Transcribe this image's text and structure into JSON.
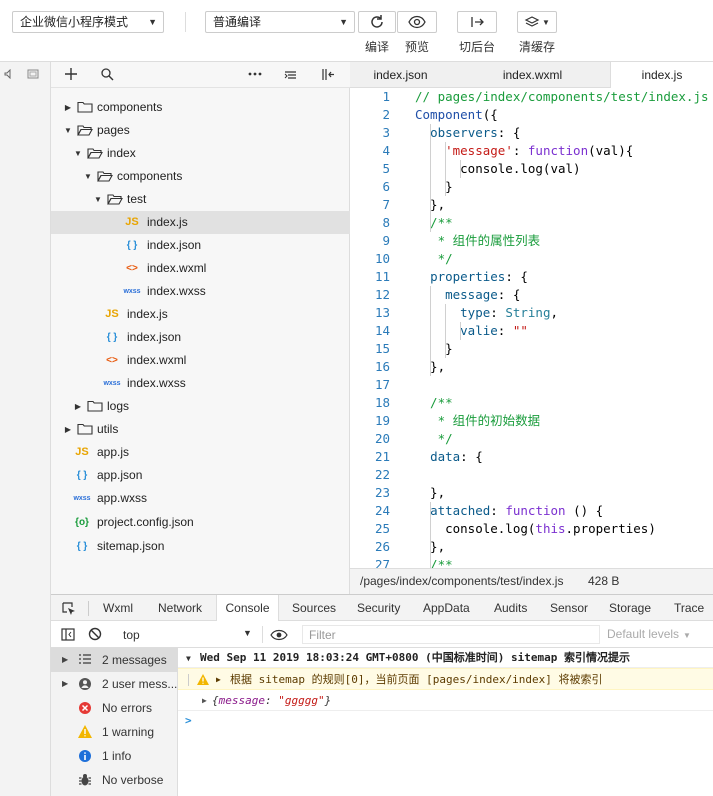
{
  "toolbar": {
    "mode_select": "企业微信小程序模式",
    "compile_select": "普通编译",
    "buttons": [
      {
        "label": "编译",
        "icon": "refresh-icon"
      },
      {
        "label": "预览",
        "icon": "eye-icon"
      },
      {
        "label": "切后台",
        "icon": "switch-background-icon"
      },
      {
        "label": "清缓存",
        "icon": "layers-icon"
      }
    ]
  },
  "tree": {
    "items": [
      {
        "label": "components",
        "type": "folder",
        "expanded": false
      },
      {
        "label": "pages",
        "type": "folder",
        "expanded": true
      },
      {
        "label": "index",
        "type": "folder",
        "expanded": true
      },
      {
        "label": "components",
        "type": "folder",
        "expanded": true
      },
      {
        "label": "test",
        "type": "folder",
        "expanded": true
      },
      {
        "label": "index.js",
        "type": "js",
        "icon_text": "JS"
      },
      {
        "label": "index.json",
        "type": "json",
        "icon_text": "{ }"
      },
      {
        "label": "index.wxml",
        "type": "wxml",
        "icon_text": "<>"
      },
      {
        "label": "index.wxss",
        "type": "wxss",
        "icon_text": "wxss"
      },
      {
        "label": "index.js",
        "type": "js",
        "icon_text": "JS"
      },
      {
        "label": "index.json",
        "type": "json",
        "icon_text": "{ }"
      },
      {
        "label": "index.wxml",
        "type": "wxml",
        "icon_text": "<>"
      },
      {
        "label": "index.wxss",
        "type": "wxss",
        "icon_text": "wxss"
      },
      {
        "label": "logs",
        "type": "folder",
        "expanded": false
      },
      {
        "label": "utils",
        "type": "folder",
        "expanded": false
      },
      {
        "label": "app.js",
        "type": "js",
        "icon_text": "JS"
      },
      {
        "label": "app.json",
        "type": "json",
        "icon_text": "{ }"
      },
      {
        "label": "app.wxss",
        "type": "wxss",
        "icon_text": "wxss"
      },
      {
        "label": "project.config.json",
        "type": "cfg",
        "icon_text": "{o}"
      },
      {
        "label": "sitemap.json",
        "type": "json",
        "icon_text": "{ }"
      }
    ]
  },
  "tabs": [
    "index.json",
    "index.wxml",
    "index.js"
  ],
  "editor": {
    "lines": [
      {
        "n": "1",
        "t": "// pages/index/components/test/index.js"
      },
      {
        "n": "2",
        "t": "Component({"
      },
      {
        "n": "3",
        "t": "  observers: {"
      },
      {
        "n": "4",
        "t": "    'message': function(val){"
      },
      {
        "n": "5",
        "t": "      console.log(val)"
      },
      {
        "n": "6",
        "t": "    }"
      },
      {
        "n": "7",
        "t": "  },"
      },
      {
        "n": "8",
        "t": "  /**"
      },
      {
        "n": "9",
        "t": "   * 组件的属性列表"
      },
      {
        "n": "10",
        "t": "   */"
      },
      {
        "n": "11",
        "t": "  properties: {"
      },
      {
        "n": "12",
        "t": "    message: {"
      },
      {
        "n": "13",
        "t": "      type: String,"
      },
      {
        "n": "14",
        "t": "      valie: \"\""
      },
      {
        "n": "15",
        "t": "    }"
      },
      {
        "n": "16",
        "t": "  },"
      },
      {
        "n": "17",
        "t": ""
      },
      {
        "n": "18",
        "t": "  /**"
      },
      {
        "n": "19",
        "t": "   * 组件的初始数据"
      },
      {
        "n": "20",
        "t": "   */"
      },
      {
        "n": "21",
        "t": "  data: {"
      },
      {
        "n": "22",
        "t": ""
      },
      {
        "n": "23",
        "t": "  },"
      },
      {
        "n": "24",
        "t": "  attached: function () {"
      },
      {
        "n": "25",
        "t": "    console.log(this.properties)"
      },
      {
        "n": "26",
        "t": "  },"
      },
      {
        "n": "27",
        "t": "  /**"
      }
    ]
  },
  "status": {
    "path": "/pages/index/components/test/index.js",
    "size": "428 B"
  },
  "devtools": {
    "tabs": [
      "Wxml",
      "Network",
      "Console",
      "Sources",
      "Security",
      "AppData",
      "Audits",
      "Sensor",
      "Storage",
      "Trace"
    ],
    "active_tab": "Console",
    "context": "top",
    "filter_placeholder": "Filter",
    "levels": "Default levels"
  },
  "console_side": [
    {
      "label": "2 messages",
      "icon": "list-icon"
    },
    {
      "label": "2 user mess...",
      "icon": "user-icon"
    },
    {
      "label": "No errors",
      "icon": "error-icon"
    },
    {
      "label": "1 warning",
      "icon": "warning-icon"
    },
    {
      "label": "1 info",
      "icon": "info-icon"
    },
    {
      "label": "No verbose",
      "icon": "bug-icon"
    }
  ],
  "console": {
    "group_header": "Wed Sep 11 2019 18:03:24 GMT+0800 (中国标准时间) sitemap 索引情况提示",
    "warning": "根据 sitemap 的规则[0]，当前页面 [pages/index/index] 将被索引",
    "object_key": "message",
    "object_value": "\"ggggg\"",
    "prompt": ">"
  },
  "colors": {
    "warning_bg": "#fffbe5",
    "accent": "#2a8fd8"
  }
}
